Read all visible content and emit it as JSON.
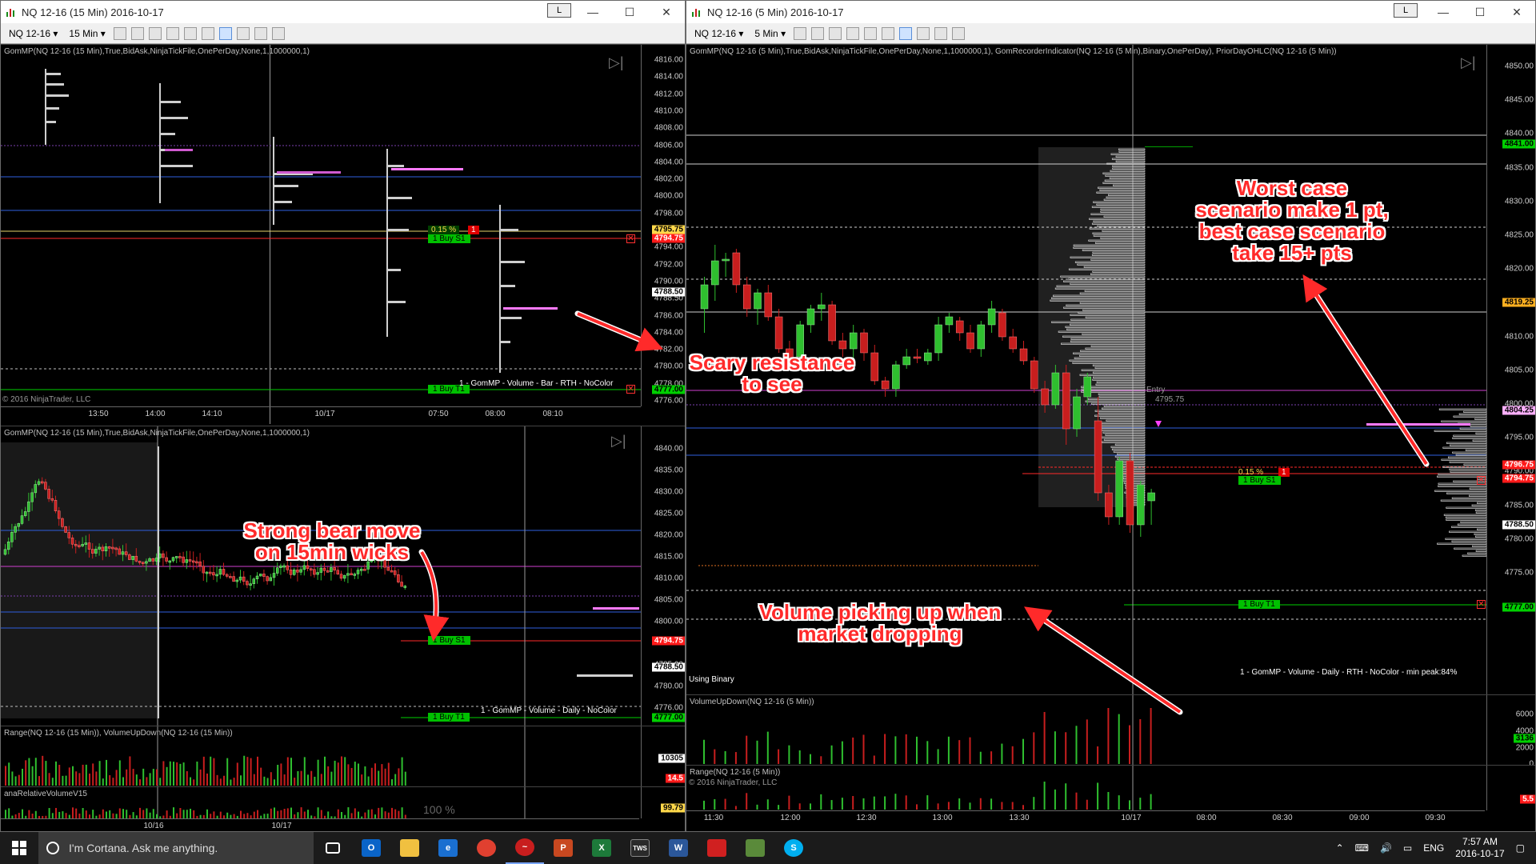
{
  "left_window": {
    "title": "NQ 12-16 (15 Min)  2016-10-17",
    "badge": "L",
    "toolbar": {
      "instrument": "NQ 12-16 ▾",
      "interval": "15 Min ▾"
    },
    "top_pane": {
      "indicator": "GomMP(NQ 12-16 (15 Min),True,BidAsk,NinjaTickFile,OnePerDay,None,1,1000000,1)",
      "price_ticks": [
        "4816.00",
        "4814.00",
        "4812.00",
        "4810.00",
        "4808.00",
        "4806.00",
        "4804.00",
        "4802.00",
        "4800.00",
        "4798.00",
        "4796.00",
        "4794.00",
        "4792.00",
        "4790.00",
        "4788.50",
        "4786.00",
        "4784.00",
        "4782.00",
        "4780.00",
        "4778.00",
        "4776.00"
      ],
      "tags": {
        "t1": "4795.75",
        "t2": "4794.75",
        "t3": "4788.50",
        "t4": "4777.00"
      },
      "x_ticks": [
        "13:50",
        "14:00",
        "14:10",
        "10/17",
        "07:50",
        "08:00",
        "08:10"
      ],
      "order_pct": "0.15 %",
      "order_qty": "1",
      "buy_s1": "1  Buy S1",
      "buy_t1": "1  Buy T1",
      "legend": "1 - GomMP - Volume - Bar - RTH - NoColor",
      "copyright": "© 2016 NinjaTrader, LLC"
    },
    "bottom_pane": {
      "indicator": "GomMP(NQ 12-16 (15 Min),True,BidAsk,NinjaTickFile,OnePerDay,None,1,1000000,1)",
      "price_ticks": [
        "4840.00",
        "4835.00",
        "4830.00",
        "4825.00",
        "4820.00",
        "4815.00",
        "4810.00",
        "4805.00",
        "4800.00",
        "4790.00",
        "4785.00",
        "4780.00",
        "4776.00"
      ],
      "tags": {
        "t1": "4794.75",
        "t2": "4788.50",
        "t3": "4777.00"
      },
      "buy_s1": "1  Buy S1",
      "buy_t1": "1  Buy T1",
      "legend": "1 - GomMP - Volume - Daily - NoColor",
      "range_title": "Range(NQ 12-16 (15 Min)), VolumeUpDown(NQ 12-16 (15 Min))",
      "range_tags": {
        "a": "10305",
        "b": "14.5"
      },
      "rel_title": "anaRelativeVolumeV15",
      "rel_pct": "100 %",
      "rel_tag": "99.79",
      "x_ticks": [
        "10/16",
        "10/17"
      ]
    }
  },
  "right_window": {
    "title": "NQ 12-16 (5 Min)  2016-10-17",
    "badge": "L",
    "toolbar": {
      "instrument": "NQ 12-16 ▾",
      "interval": "5 Min ▾"
    },
    "main_pane": {
      "indicator": "GomMP(NQ 12-16 (5 Min),True,BidAsk,NinjaTickFile,OnePerDay,None,1,1000000,1), GomRecorderIndicator(NQ 12-16 (5 Min),Binary,OnePerDay), PriorDayOHLC(NQ 12-16 (5 Min))",
      "price_ticks": [
        "4850.00",
        "4845.00",
        "4840.00",
        "4835.00",
        "4830.00",
        "4825.00",
        "4820.00",
        "4815.00",
        "4810.00",
        "4805.00",
        "4800.00",
        "4795.00",
        "4790.00",
        "4785.00",
        "4780.00",
        "4775.00",
        "4770.00"
      ],
      "tags": {
        "t1": "4841.00",
        "t2": "4819.25",
        "t3": "4804.25",
        "t4": "4796.75",
        "t5": "4794.75",
        "t6": "4788.50",
        "t7": "4777.00"
      },
      "entry_label": "Entry",
      "entry_price": "4795.75",
      "order_pct": "0.15 %",
      "order_qty": "1",
      "buy_s1": "1  Buy S1",
      "buy_t1": "1  Buy T1",
      "using_binary": "Using Binary",
      "legend": "1 - GomMP - Volume - Daily - RTH - NoColor - min peak:84%"
    },
    "vol_pane": {
      "title": "VolumeUpDown(NQ 12-16 (5 Min))",
      "ticks": [
        "6000",
        "4000",
        "2000",
        "0"
      ],
      "tag": "3136"
    },
    "range_pane": {
      "title": "Range(NQ 12-16 (5 Min))",
      "copyright": "© 2016 NinjaTrader, LLC",
      "tag": "5.5"
    },
    "x_ticks": [
      "11:30",
      "12:00",
      "12:30",
      "13:00",
      "13:30",
      "10/17",
      "08:00",
      "08:30",
      "09:00",
      "09:30"
    ]
  },
  "annotations": {
    "worst_case": "Worst case\nscenario make 1 pt,\nbest case scenario\ntake 15+ pts",
    "scary": "Scary resistance\nto see",
    "bear": "Strong bear move\non 15min wicks",
    "volume": "Volume picking up when\nmarket dropping"
  },
  "taskbar": {
    "search": "I'm Cortana. Ask me anything.",
    "lang": "ENG",
    "time": "7:57 AM",
    "date": "2016-10-17"
  },
  "colors": {
    "up": "#2fbf2f",
    "down": "#c81e1e",
    "buy": "#00d000",
    "sell": "#ff1a1a",
    "accent": "#ff2a2a"
  }
}
